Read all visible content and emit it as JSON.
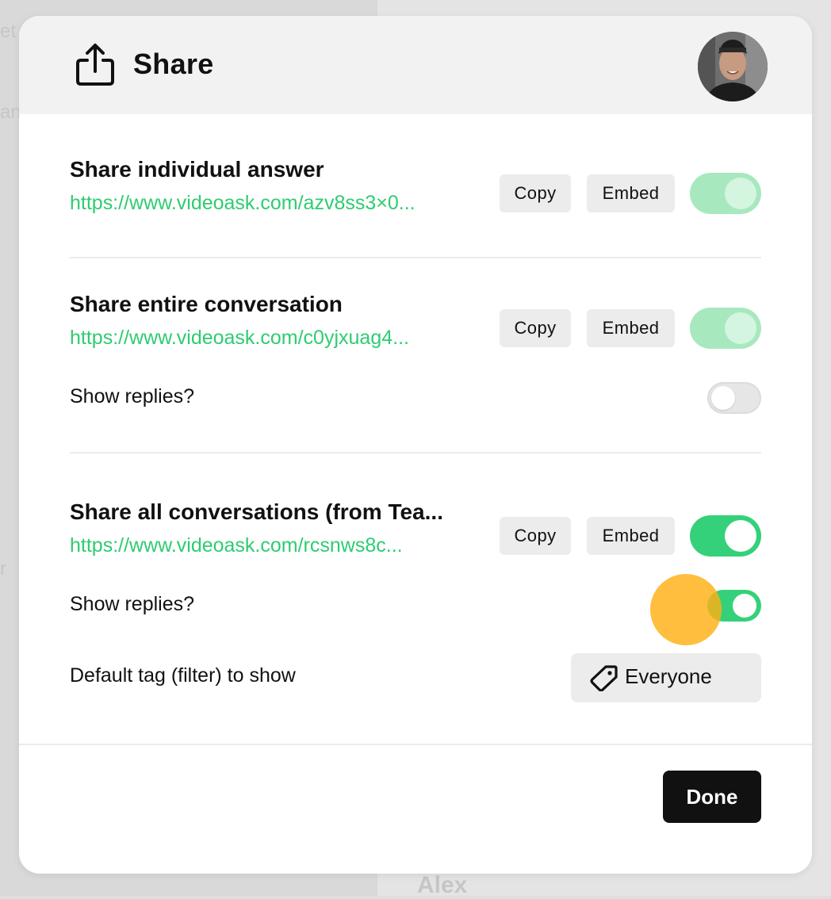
{
  "background": {
    "fragments": [
      "et",
      "an",
      "r",
      "Alex"
    ]
  },
  "header": {
    "title": "Share",
    "icon": "share-upload-icon"
  },
  "sections": {
    "individual": {
      "title": "Share individual answer",
      "link": "https://www.videoask.com/azv8ss3×0...",
      "copy_label": "Copy",
      "embed_label": "Embed",
      "enabled": true
    },
    "conversation": {
      "title": "Share entire conversation",
      "link": "https://www.videoask.com/c0yjxuag4...",
      "copy_label": "Copy",
      "embed_label": "Embed",
      "enabled": true,
      "show_replies_label": "Show replies?",
      "show_replies": false
    },
    "all": {
      "title": "Share all conversations (from Tea...",
      "link": "https://www.videoask.com/rcsnws8c...",
      "copy_label": "Copy",
      "embed_label": "Embed",
      "enabled": true,
      "show_replies_label": "Show replies?",
      "show_replies": true,
      "default_tag_label": "Default tag (filter) to show",
      "default_tag_value": "Everyone",
      "default_tag_icon": "tag-icon"
    }
  },
  "footer": {
    "done_label": "Done"
  },
  "colors": {
    "link_green": "#2ecc71",
    "toggle_on": "#34d17a",
    "toggle_faded": "#a8e8bf",
    "cursor_highlight": "#ffb014"
  }
}
